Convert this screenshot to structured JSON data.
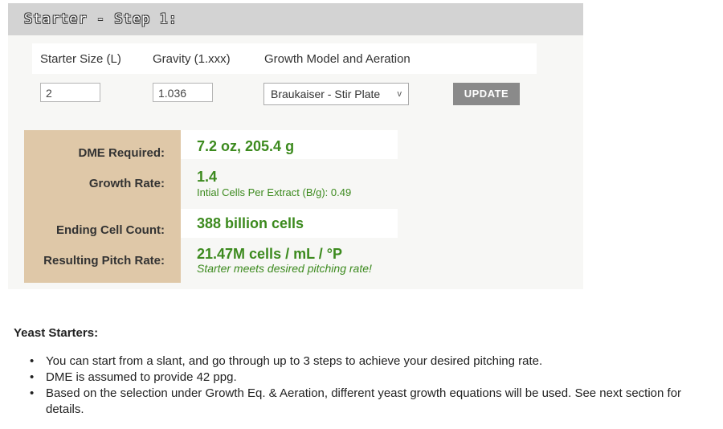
{
  "step": {
    "title": "Starter - Step 1:"
  },
  "form": {
    "labels": {
      "size": "Starter Size (L)",
      "gravity": "Gravity (1.xxx)",
      "model": "Growth Model and Aeration"
    },
    "size_value": "2",
    "gravity_value": "1.036",
    "model_value": "Braukaiser - Stir Plate",
    "update_label": "UPDATE",
    "select_arrow": "v"
  },
  "results": {
    "dme_label": "DME Required:",
    "dme_value": "7.2 oz, 205.4 g",
    "growth_label": "Growth Rate:",
    "growth_value": "1.4",
    "growth_sub": "Intial Cells Per Extract (B/g): 0.49",
    "ending_label": "Ending Cell Count:",
    "ending_value": "388 billion cells",
    "pitch_label": "Resulting Pitch Rate:",
    "pitch_value": "21.47M cells / mL / °P",
    "pitch_note": "Starter meets desired pitching rate!"
  },
  "info": {
    "title": "Yeast Starters:",
    "bullet": "•",
    "items": [
      "You can start from a slant, and go through up to 3 steps to achieve your desired pitching rate.",
      "DME is assumed to provide 42 ppg.",
      "Based on the selection under Growth Eq. & Aeration, different yeast growth equations will be used. See next section for details."
    ]
  },
  "colors": {
    "value_green": "#3c8a1e",
    "label_tan": "#dfc8a8",
    "header_gray": "#d3d3d3",
    "button_gray": "#8a8a8a"
  }
}
